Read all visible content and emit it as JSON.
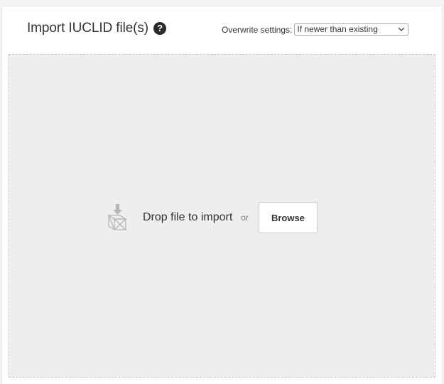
{
  "header": {
    "title": "Import IUCLID file(s)",
    "help_icon": "question-circle-icon",
    "help_glyph": "?"
  },
  "overwrite": {
    "label": "Overwrite settings:",
    "selected": "If newer than existing"
  },
  "dropzone": {
    "icon": "box-import-icon",
    "drop_text": "Drop file to import",
    "or_text": "or",
    "browse_label": "Browse"
  },
  "colors": {
    "dropzone_background": "#eeeeee",
    "text": "#333333",
    "muted_text": "#777777"
  }
}
